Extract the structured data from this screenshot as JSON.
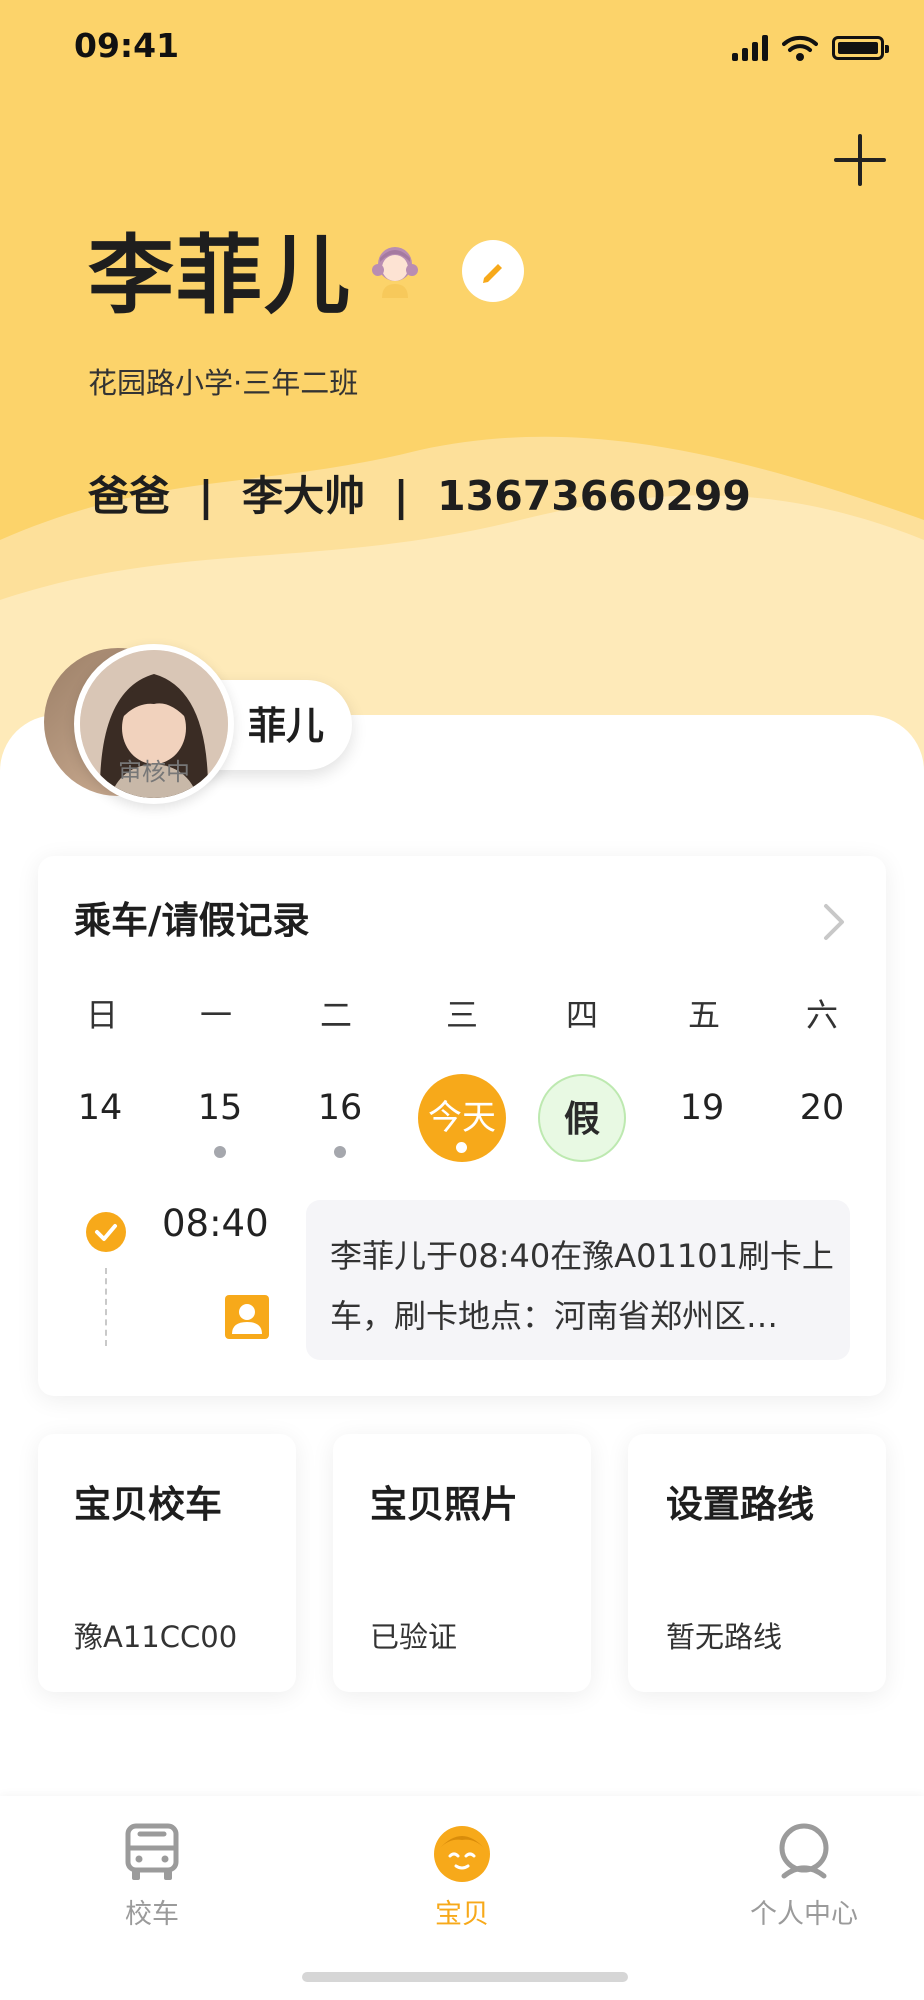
{
  "status_bar": {
    "time": "09:41"
  },
  "profile": {
    "name": "李菲儿",
    "school_class": "花园路小学·三年二班",
    "guardian_line": "爸爸  |  李大帅  |  13673660299",
    "nickname": "菲儿",
    "avatar_status": "审核中"
  },
  "records": {
    "title": "乘车/请假记录",
    "weekdays": [
      "日",
      "一",
      "二",
      "三",
      "四",
      "五",
      "六"
    ],
    "days": [
      "14",
      "15",
      "16",
      "今天",
      "假",
      "19",
      "20"
    ],
    "entry": {
      "time": "08:40",
      "text_line1": "李菲儿于08:40在豫A01101刷卡上",
      "text_line2": "车，刷卡地点：河南省郑州区…"
    }
  },
  "cards": [
    {
      "title": "宝贝校车",
      "value": "豫A11CC00"
    },
    {
      "title": "宝贝照片",
      "value": "已验证"
    },
    {
      "title": "设置路线",
      "value": "暂无路线"
    }
  ],
  "tabbar": {
    "items": [
      {
        "label": "校车",
        "icon": "bus-icon"
      },
      {
        "label": "宝贝",
        "icon": "baby-face-icon"
      },
      {
        "label": "个人中心",
        "icon": "user-icon"
      }
    ],
    "active_color": "#f7a91a",
    "inactive_color": "#9b9b9b"
  },
  "colors": {
    "header_yellow": "#fcd36a",
    "accent_orange": "#f7a91a",
    "leave_green_bg": "#e8f9e3"
  }
}
